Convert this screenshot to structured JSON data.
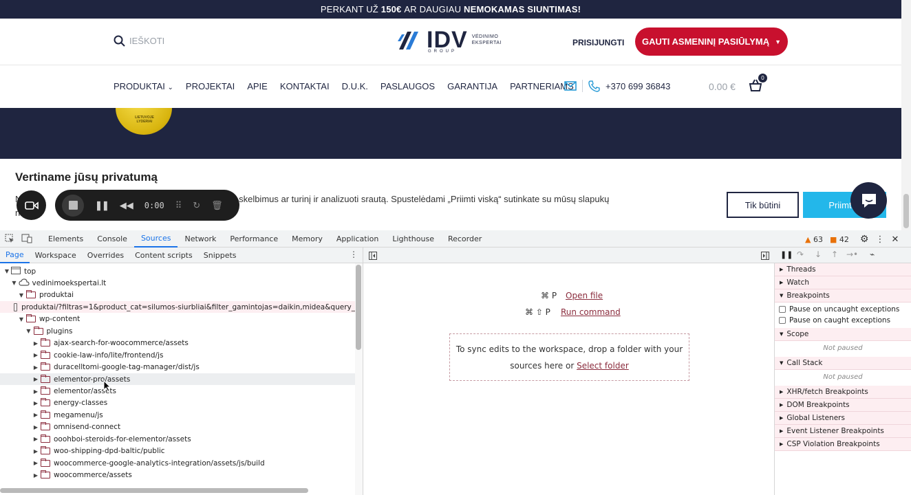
{
  "site": {
    "promo": {
      "prefix": "PERKANT UŽ",
      "amount": "150€",
      "middle": "AR DAUGIAU",
      "free": "NEMOKAMAS SIUNTIMAS!"
    },
    "search_placeholder": "IEŠKOTI",
    "logo": {
      "word": "IDV",
      "sub1": "VĖDINIMO",
      "sub2": "EKSPERTAI",
      "group": "GROUP"
    },
    "login": "PRISIJUNGTI",
    "cta": "GAUTI ASMENINĮ PASIŪLYMĄ",
    "nav": [
      "PRODUKTAI",
      "PROJEKTAI",
      "APIE",
      "KONTAKTAI",
      "D.U.K.",
      "PASLAUGOS",
      "GARANTIJA",
      "PARTNERIAMS"
    ],
    "phone": "+370 699 36843",
    "cart_total": "0.00 €",
    "cart_count": "0",
    "medal_text": "LIETUVOJE LYDERIAI",
    "cookie": {
      "title": "Vertiname jūsų privatumą",
      "text_line1": "N                                                  irtį, teikti suasmenintus skelbimus ar turinį ir analizuoti srautą. Spustelėdami „Priimti viską“ sutinkate su mūsų slapukų",
      "text_line2": "n",
      "btn_necessary": "Tik būtini",
      "btn_accept": "Priimti v"
    }
  },
  "recorder": {
    "time": "0:00"
  },
  "devtools": {
    "tabs": [
      "Elements",
      "Console",
      "Sources",
      "Network",
      "Performance",
      "Memory",
      "Application",
      "Lighthouse",
      "Recorder"
    ],
    "warnings": "63",
    "errors": "42",
    "subtabs": [
      "Page",
      "Workspace",
      "Overrides",
      "Content scripts",
      "Snippets"
    ],
    "tree": [
      {
        "depth": 0,
        "type": "frame",
        "label": "top",
        "open": true
      },
      {
        "depth": 1,
        "type": "cloud",
        "label": "vedinimoekspertai.lt",
        "open": true
      },
      {
        "depth": 2,
        "type": "folder",
        "label": "produktai",
        "open": true
      },
      {
        "depth": 3,
        "type": "file",
        "label": "produktai/?filtras=1&product_cat=silumos-siurbliai&filter_gamintojas=daikin,midea&query_"
      },
      {
        "depth": 2,
        "type": "folder",
        "label": "wp-content",
        "open": true
      },
      {
        "depth": 3,
        "type": "folder",
        "label": "plugins",
        "open": true
      },
      {
        "depth": 4,
        "type": "folder",
        "label": "ajax-search-for-woocommerce/assets"
      },
      {
        "depth": 4,
        "type": "folder",
        "label": "cookie-law-info/lite/frontend/js"
      },
      {
        "depth": 4,
        "type": "folder",
        "label": "duracelltomi-google-tag-manager/dist/js"
      },
      {
        "depth": 4,
        "type": "folder",
        "label": "elementor-pro/assets",
        "hl": true
      },
      {
        "depth": 4,
        "type": "folder",
        "label": "elementor/assets"
      },
      {
        "depth": 4,
        "type": "folder",
        "label": "energy-classes"
      },
      {
        "depth": 4,
        "type": "folder",
        "label": "megamenu/js"
      },
      {
        "depth": 4,
        "type": "folder",
        "label": "omnisend-connect"
      },
      {
        "depth": 4,
        "type": "folder",
        "label": "ooohboi-steroids-for-elementor/assets"
      },
      {
        "depth": 4,
        "type": "folder",
        "label": "woo-shipping-dpd-baltic/public"
      },
      {
        "depth": 4,
        "type": "folder",
        "label": "woocommerce-google-analytics-integration/assets/js/build"
      },
      {
        "depth": 4,
        "type": "folder",
        "label": "woocommerce/assets"
      }
    ],
    "editor": {
      "open_file_keys": "⌘ P",
      "open_file": "Open file",
      "run_command_keys": "⌘ ⇧ P",
      "run_command": "Run command",
      "drop_text1": "To sync edits to the workspace, drop a folder with your",
      "drop_text2": "sources here or",
      "select_folder": "Select folder"
    },
    "debugger": {
      "threads": "Threads",
      "watch": "Watch",
      "breakpoints": "Breakpoints",
      "pause_uncaught": "Pause on uncaught exceptions",
      "pause_caught": "Pause on caught exceptions",
      "scope": "Scope",
      "not_paused": "Not paused",
      "call_stack": "Call Stack",
      "xhr": "XHR/fetch Breakpoints",
      "dom": "DOM Breakpoints",
      "global": "Global Listeners",
      "event": "Event Listener Breakpoints",
      "csp": "CSP Violation Breakpoints"
    }
  }
}
